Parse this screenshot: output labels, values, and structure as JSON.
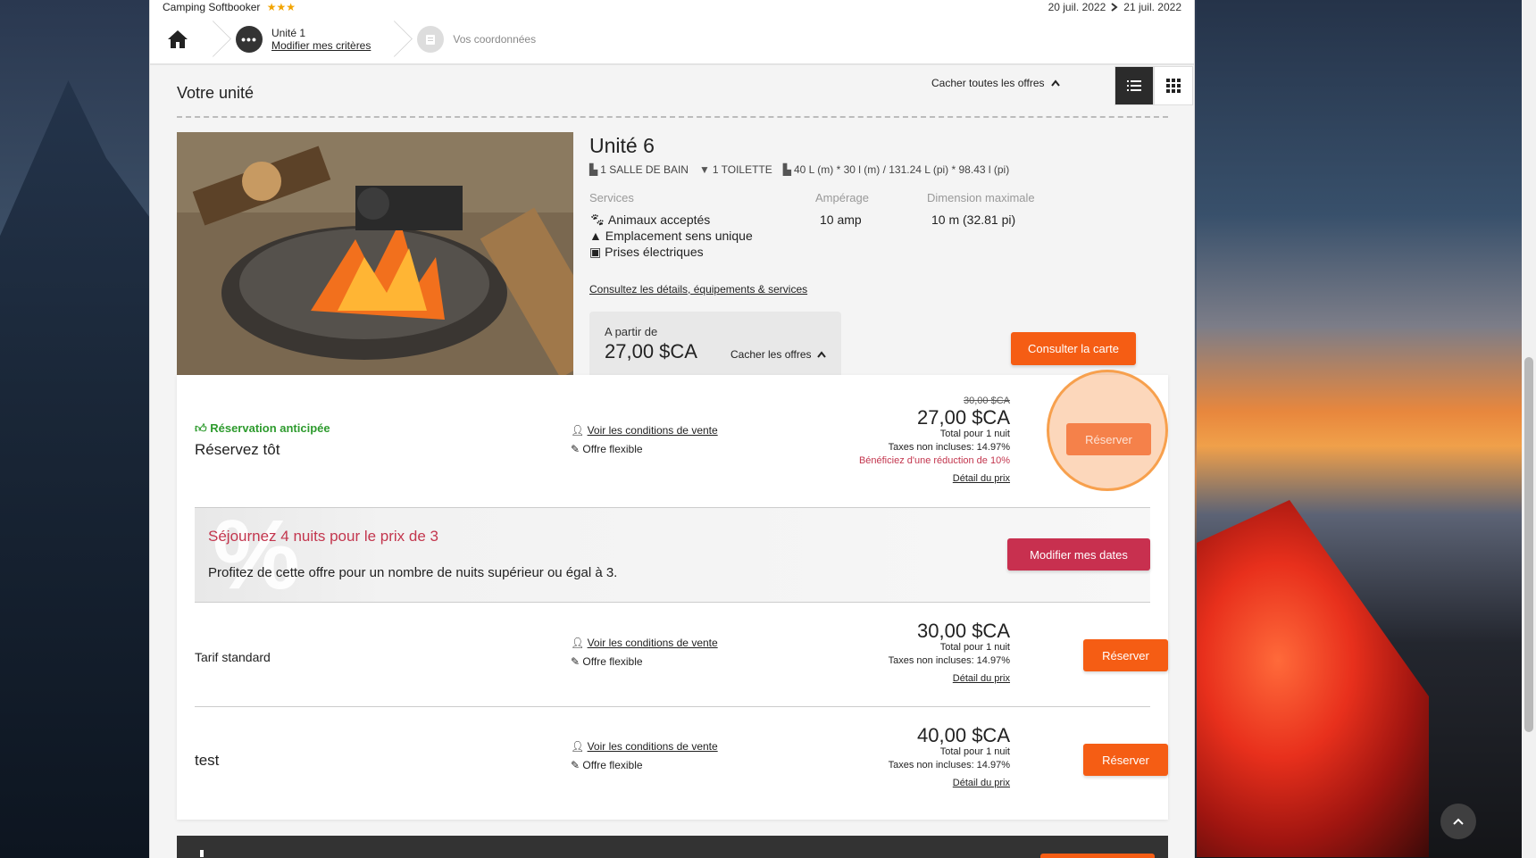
{
  "brand": {
    "name": "Camping Softbooker",
    "stars": "★★★"
  },
  "dates": {
    "from": "20 juil. 2022",
    "to": "21 juil. 2022"
  },
  "steps": [
    {
      "title": "Unité 1",
      "link": "Modifier mes critères"
    },
    {
      "title": "Vos coordonnées"
    }
  ],
  "section": {
    "title": "Votre unité",
    "hide_all": "Cacher toutes les offres"
  },
  "unit": {
    "name": "Unité 6",
    "specs": [
      "1 SALLE DE BAIN",
      "1 TOILETTE",
      "40 L (m) * 30 l (m) / 131.24 L (pi) * 98.43 l (pi)"
    ],
    "services_label": "Services",
    "services": [
      "Animaux acceptés",
      "Emplacement sens unique",
      "Prises électriques"
    ],
    "amperage_label": "Ampérage",
    "amperage": "10 amp",
    "dimension_label": "Dimension maximale",
    "dimension": "10 m (32.81 pi)",
    "details_link": "Consultez les détails, équipements & services",
    "from_label": "A partir de",
    "from_price": "27,00 $CA",
    "hide_offers": "Cacher les offres",
    "map_button": "Consulter la carte"
  },
  "common": {
    "conditions": "Voir les conditions de vente",
    "flexible": "Offre flexible",
    "total": "Total pour 1 nuit",
    "taxes": "Taxes non incluses: 14.97%",
    "detail": "Détail du prix",
    "reserve": "Réserver"
  },
  "offers": [
    {
      "tag": "Réservation anticipée",
      "name": "Réservez tôt",
      "old_price": "30,00 $CA",
      "price": "27,00 $CA",
      "promo": "Bénéficiez d'une réduction de 10%"
    },
    {
      "name": "Tarif standard",
      "price": "30,00 $CA"
    },
    {
      "name": "test",
      "price": "40,00 $CA"
    }
  ],
  "promo": {
    "title": "Séjournez 4 nuits pour le prix de 3",
    "desc": "Profitez de cette offre pour un nombre de nuits supérieur ou égal à 3.",
    "button": "Modifier mes dates"
  },
  "colors": {
    "accent": "#f55d14",
    "promo": "#c8304f",
    "green": "#2e9b2e"
  }
}
